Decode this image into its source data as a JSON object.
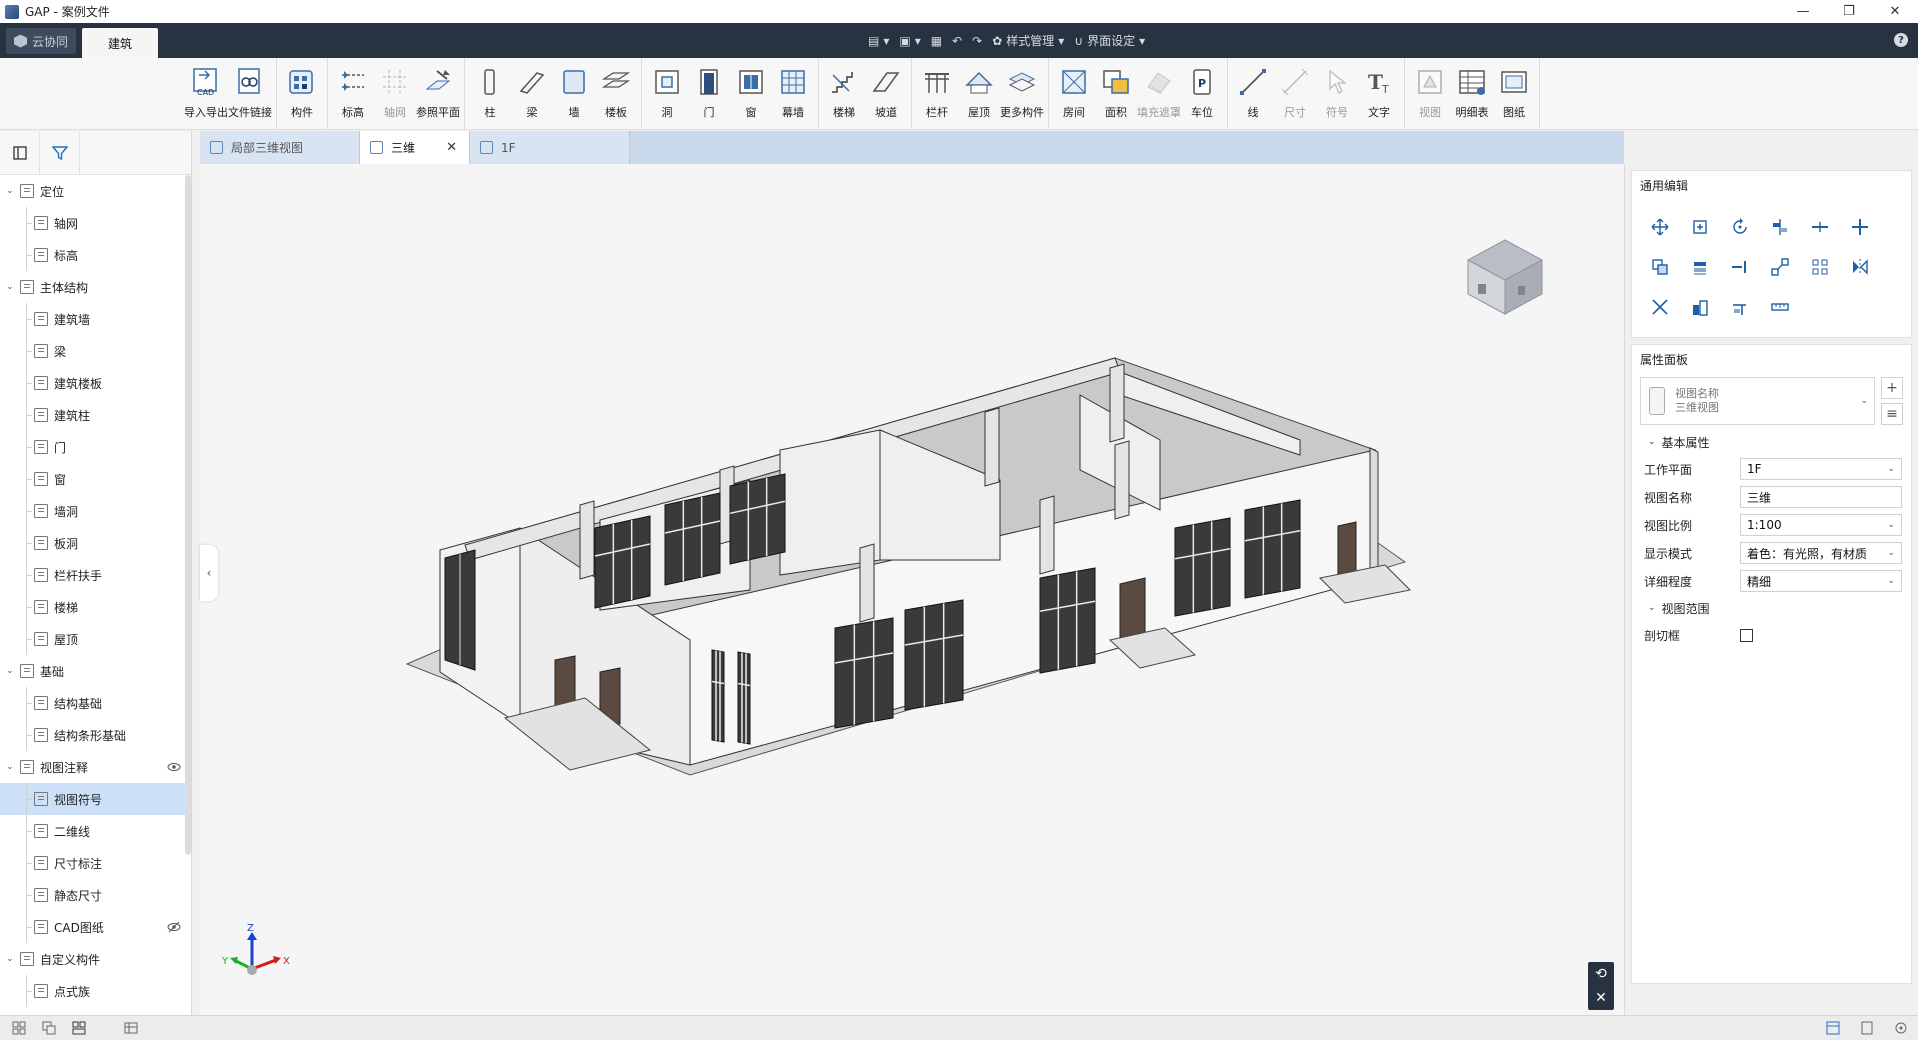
{
  "window": {
    "title": "GAP - 案例文件",
    "controls": [
      "—",
      "❐",
      "✕"
    ]
  },
  "topbar": {
    "cloud_label": "云协同",
    "main_tab": "建筑",
    "style_mgmt": "样式管理",
    "ui_settings": "界面设定",
    "help": "?"
  },
  "ribbon": {
    "groups": [
      [
        {
          "label": "导入导出",
          "icon": "cad-import-icon"
        },
        {
          "label": "文件链接",
          "icon": "file-link-icon"
        }
      ],
      [
        {
          "label": "构件",
          "icon": "component-icon"
        }
      ],
      [
        {
          "label": "标高",
          "icon": "level-icon"
        },
        {
          "label": "轴网",
          "icon": "grid-icon",
          "disabled": true
        },
        {
          "label": "参照平面",
          "icon": "ref-plane-icon"
        }
      ],
      [
        {
          "label": "柱",
          "icon": "column-icon"
        },
        {
          "label": "梁",
          "icon": "beam-icon"
        },
        {
          "label": "墙",
          "icon": "wall-icon"
        },
        {
          "label": "楼板",
          "icon": "slab-icon"
        }
      ],
      [
        {
          "label": "洞",
          "icon": "opening-icon"
        },
        {
          "label": "门",
          "icon": "door-icon"
        },
        {
          "label": "窗",
          "icon": "window-icon"
        },
        {
          "label": "幕墙",
          "icon": "curtain-wall-icon"
        }
      ],
      [
        {
          "label": "楼梯",
          "icon": "stair-icon"
        },
        {
          "label": "坡道",
          "icon": "ramp-icon"
        }
      ],
      [
        {
          "label": "栏杆",
          "icon": "railing-icon"
        },
        {
          "label": "屋顶",
          "icon": "roof-icon"
        },
        {
          "label": "更多构件",
          "icon": "more-components-icon"
        }
      ],
      [
        {
          "label": "房间",
          "icon": "room-icon"
        },
        {
          "label": "面积",
          "icon": "area-icon"
        },
        {
          "label": "填充遮罩",
          "icon": "fill-mask-icon",
          "disabled": true
        },
        {
          "label": "车位",
          "icon": "parking-icon"
        }
      ],
      [
        {
          "label": "线",
          "icon": "line-icon"
        },
        {
          "label": "尺寸",
          "icon": "dimension-icon",
          "disabled": true
        },
        {
          "label": "符号",
          "icon": "symbol-icon",
          "disabled": true
        },
        {
          "label": "文字",
          "icon": "text-icon"
        }
      ],
      [
        {
          "label": "视图",
          "icon": "view-icon",
          "disabled": true
        },
        {
          "label": "明细表",
          "icon": "schedule-icon"
        },
        {
          "label": "图纸",
          "icon": "sheet-icon"
        }
      ]
    ]
  },
  "tree": {
    "nodes": [
      {
        "label": "定位",
        "type": "cat"
      },
      {
        "label": "轴网",
        "type": "leaf"
      },
      {
        "label": "标高",
        "type": "leaf"
      },
      {
        "label": "主体结构",
        "type": "cat"
      },
      {
        "label": "建筑墙",
        "type": "leaf"
      },
      {
        "label": "梁",
        "type": "leaf"
      },
      {
        "label": "建筑楼板",
        "type": "leaf"
      },
      {
        "label": "建筑柱",
        "type": "leaf"
      },
      {
        "label": "门",
        "type": "leaf"
      },
      {
        "label": "窗",
        "type": "leaf"
      },
      {
        "label": "墙洞",
        "type": "leaf"
      },
      {
        "label": "板洞",
        "type": "leaf"
      },
      {
        "label": "栏杆扶手",
        "type": "leaf"
      },
      {
        "label": "楼梯",
        "type": "leaf"
      },
      {
        "label": "屋顶",
        "type": "leaf"
      },
      {
        "label": "基础",
        "type": "cat"
      },
      {
        "label": "结构基础",
        "type": "leaf"
      },
      {
        "label": "结构条形基础",
        "type": "leaf"
      },
      {
        "label": "视图注释",
        "type": "cat",
        "eye": "visible"
      },
      {
        "label": "视图符号",
        "type": "leaf",
        "selected": true
      },
      {
        "label": "二维线",
        "type": "leaf"
      },
      {
        "label": "尺寸标注",
        "type": "leaf"
      },
      {
        "label": "静态尺寸",
        "type": "leaf"
      },
      {
        "label": "CAD图纸",
        "type": "leaf",
        "eye": "hidden"
      },
      {
        "label": "自定义构件",
        "type": "cat"
      },
      {
        "label": "点式族",
        "type": "leaf"
      }
    ]
  },
  "doc_tabs": [
    {
      "label": "局部三维视图",
      "active": false
    },
    {
      "label": "三维",
      "active": true
    },
    {
      "label": "1F",
      "active": false
    }
  ],
  "right_panel": {
    "edit_title": "通用编辑",
    "props_title": "属性面板",
    "type_line1": "视图名称",
    "type_line2": "三维视图",
    "group_basic": "基本属性",
    "group_range": "视图范围",
    "rows": [
      {
        "key": "工作平面",
        "value": "1F",
        "dropdown": true
      },
      {
        "key": "视图名称",
        "value": "三维",
        "dropdown": false
      },
      {
        "key": "视图比例",
        "value": "1:100",
        "dropdown": true
      },
      {
        "key": "显示模式",
        "value": "着色：有光照，有材质",
        "dropdown": true
      },
      {
        "key": "详细程度",
        "value": "精细",
        "dropdown": true
      }
    ],
    "section_box_label": "剖切框"
  },
  "viewport": {
    "axis_x": "X",
    "axis_y": "Y",
    "axis_z": "Z"
  }
}
